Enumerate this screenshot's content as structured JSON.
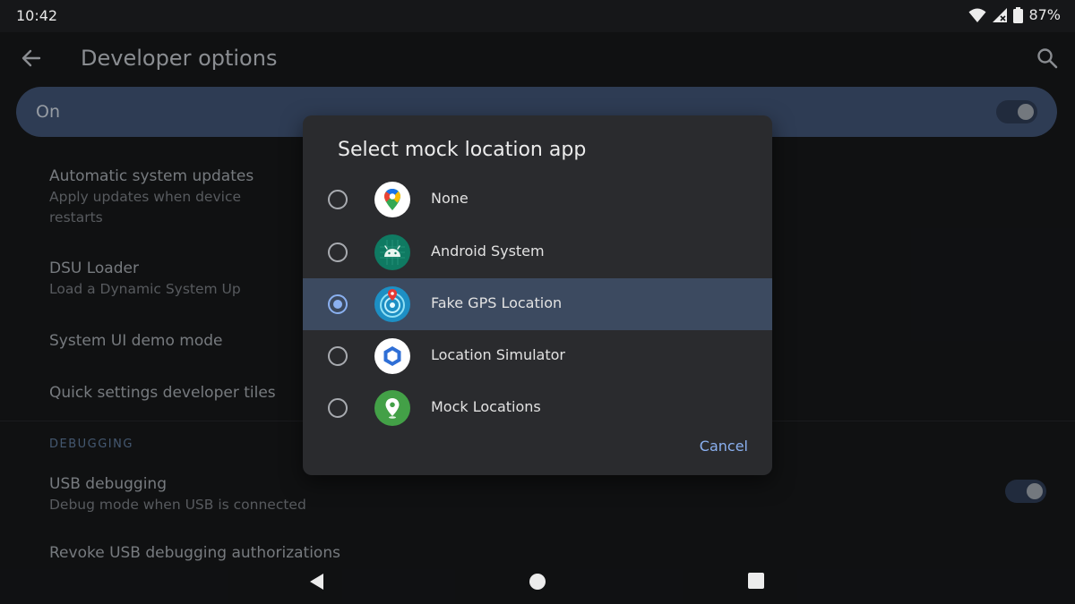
{
  "status_bar": {
    "time": "10:42",
    "battery": "87%"
  },
  "app_bar": {
    "title": "Developer options"
  },
  "main_switch": {
    "label": "On",
    "checked": true
  },
  "settings": [
    {
      "title": "Automatic system updates",
      "summary_line1": "Apply updates when device",
      "summary_line2": "restarts"
    },
    {
      "title": "DSU Loader",
      "summary": "Load a Dynamic System Up"
    },
    {
      "title": "System UI demo mode"
    },
    {
      "title": "Quick settings developer tiles"
    }
  ],
  "debugging": {
    "header": "DEBUGGING",
    "usb_debugging": {
      "title": "USB debugging",
      "summary": "Debug mode when USB is connected",
      "checked": false
    },
    "revoke": {
      "title": "Revoke USB debugging authorizations"
    }
  },
  "dialog": {
    "title": "Select mock location app",
    "options": [
      {
        "label": "None",
        "icon": "google-maps-icon",
        "selected": false
      },
      {
        "label": "Android System",
        "icon": "android-system-icon",
        "selected": false
      },
      {
        "label": "Fake GPS Location",
        "icon": "fake-gps-icon",
        "selected": true
      },
      {
        "label": "Location Simulator",
        "icon": "location-simulator-icon",
        "selected": false
      },
      {
        "label": "Mock Locations",
        "icon": "mock-locations-icon",
        "selected": false
      }
    ],
    "cancel_label": "Cancel"
  },
  "colors": {
    "accent": "#8ab0f0",
    "switch_bar": "#3e5070",
    "dialog_bg": "#2a2b2e",
    "selected_row": "#3c4a60"
  }
}
